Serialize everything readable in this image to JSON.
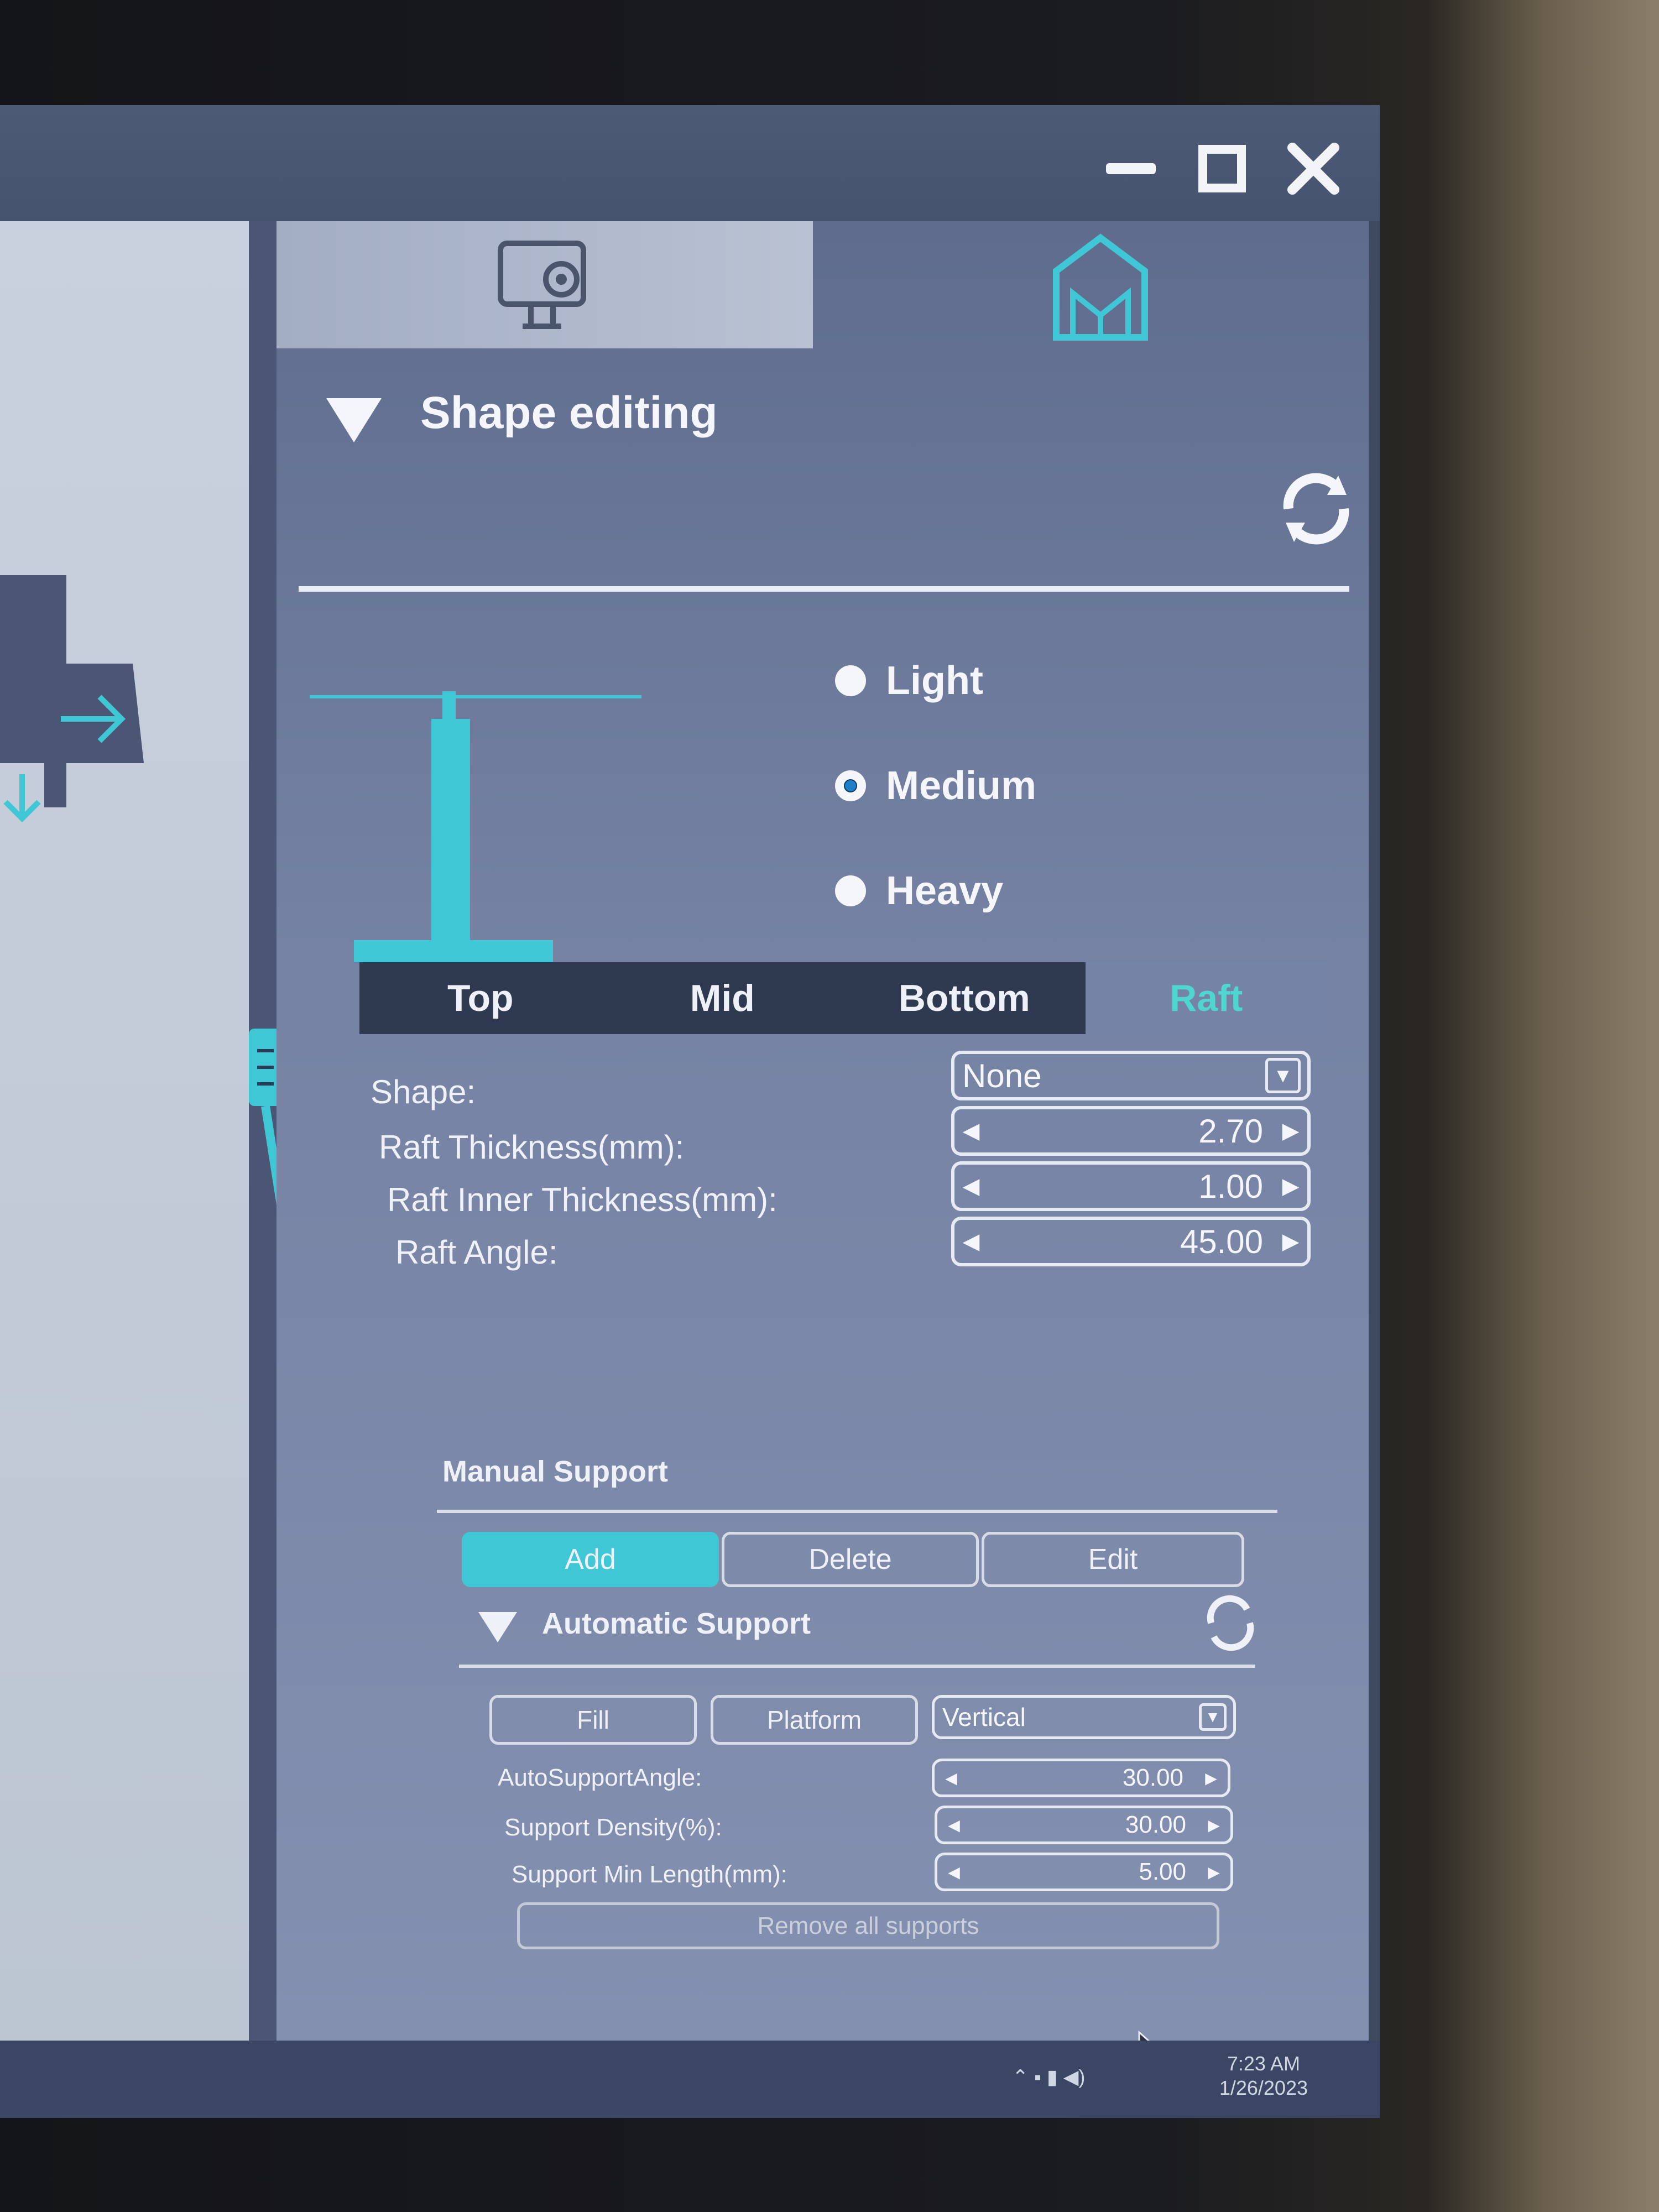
{
  "window": {
    "minimize_icon": "minimize-icon",
    "maximize_icon": "maximize-icon",
    "close_icon": "close-icon"
  },
  "tabs_top": {
    "left_icon": "monitor-gear-icon",
    "right_icon": "support-structure-icon"
  },
  "shape_editing": {
    "title": "Shape editing",
    "options": [
      {
        "label": "Light",
        "selected": false
      },
      {
        "label": "Medium",
        "selected": true
      },
      {
        "label": "Heavy",
        "selected": false
      }
    ],
    "tabs": [
      "Top",
      "Mid",
      "Bottom",
      "Raft"
    ],
    "active_tab": "Raft",
    "fields": {
      "shape": {
        "label": "Shape:",
        "value": "None"
      },
      "raft_thickness": {
        "label": "Raft Thickness(mm):",
        "value": "2.70"
      },
      "raft_inner_thickness": {
        "label": "Raft Inner Thickness(mm):",
        "value": "1.00"
      },
      "raft_angle": {
        "label": "Raft Angle:",
        "value": "45.00"
      }
    }
  },
  "manual_support": {
    "title": "Manual Support",
    "buttons": [
      "Add",
      "Delete",
      "Edit"
    ],
    "active": "Add"
  },
  "automatic_support": {
    "title": "Automatic Support",
    "fill": "Fill",
    "platform": "Platform",
    "direction": "Vertical",
    "fields": {
      "angle": {
        "label": "AutoSupportAngle:",
        "value": "30.00"
      },
      "density": {
        "label": "Support Density(%):",
        "value": "30.00"
      },
      "min_length": {
        "label": "Support Min Length(mm):",
        "value": "5.00"
      }
    },
    "remove_all": "Remove all supports"
  },
  "taskbar": {
    "time": "7:23 AM",
    "date": "1/26/2023"
  },
  "colors": {
    "accent": "#3fc7d6",
    "panel": "#7582a3",
    "titlebar": "#46536f"
  }
}
